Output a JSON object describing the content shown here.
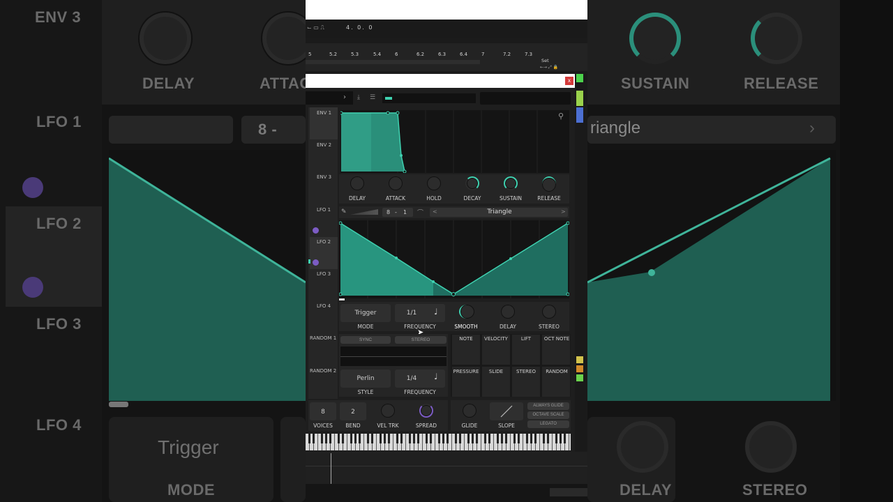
{
  "background": {
    "left_labels": [
      "ENV 3",
      "LFO 1",
      "LFO 2",
      "LFO 3",
      "LFO 4"
    ],
    "left_knob_labels": [
      "DELAY",
      "ATTAC"
    ],
    "right_knob_labels": [
      "SUSTAIN",
      "RELEASE"
    ],
    "right_wave_label": "riangle",
    "bottom_left_label": "MODE",
    "bottom_left_value": "Trigger",
    "bottom_right_labels": [
      "DELAY",
      "STEREO"
    ],
    "lfo_rate_partial": "8  -"
  },
  "timeline": {
    "position": "4. 0. 0",
    "ruler": [
      "5",
      "5.2",
      "5.3",
      "5.4",
      "6",
      "6.2",
      "6.3",
      "6.4",
      "7",
      "7.2",
      "7.3"
    ],
    "set_label": "Set"
  },
  "window": {
    "close_label": "x"
  },
  "envelopes": {
    "tabs": [
      "ENV 1",
      "ENV 2",
      "ENV 3"
    ],
    "knobs": [
      "DELAY",
      "ATTACK",
      "HOLD",
      "DECAY",
      "SUSTAIN",
      "RELEASE"
    ]
  },
  "lfo": {
    "tabs": [
      "LFO 1",
      "LFO 2",
      "LFO 3",
      "LFO 4"
    ],
    "rate_num": "8",
    "rate_sep": "-",
    "rate_den": "1",
    "shape_name": "Triangle",
    "prev_arrow": "<",
    "next_arrow": ">",
    "mode_value": "Trigger",
    "mode_label": "MODE",
    "frequency_value": "1/1",
    "frequency_label": "FREQUENCY",
    "knobs": [
      "SMOOTH",
      "DELAY",
      "STEREO"
    ]
  },
  "random": {
    "tabs": [
      "RANDOM 1",
      "RANDOM 2"
    ],
    "sync_label": "SYNC",
    "stereo_label": "STEREO",
    "style_value": "Perlin",
    "style_label": "STYLE",
    "frequency_value": "1/4",
    "frequency_label": "FREQUENCY"
  },
  "mod_sources": {
    "row1": [
      "NOTE",
      "VELOCITY",
      "LIFT",
      "OCT NOTE"
    ],
    "row2": [
      "PRESSURE",
      "SLIDE",
      "STEREO",
      "RANDOM"
    ]
  },
  "voice": {
    "voices_value": "8",
    "voices_label": "VOICES",
    "bend_value": "2",
    "bend_label": "BEND",
    "veltrk_label": "VEL TRK",
    "spread_label": "SPREAD",
    "glide_label": "GLIDE",
    "slope_label": "SLOPE",
    "options": [
      "ALWAYS GLIDE",
      "OCTAVE SCALE",
      "LEGATO"
    ]
  },
  "colors": {
    "accent": "#3fd1b0",
    "accent_dim": "#2a8f7a",
    "purple": "#7c5cc4",
    "panel": "#1e1e1e"
  }
}
